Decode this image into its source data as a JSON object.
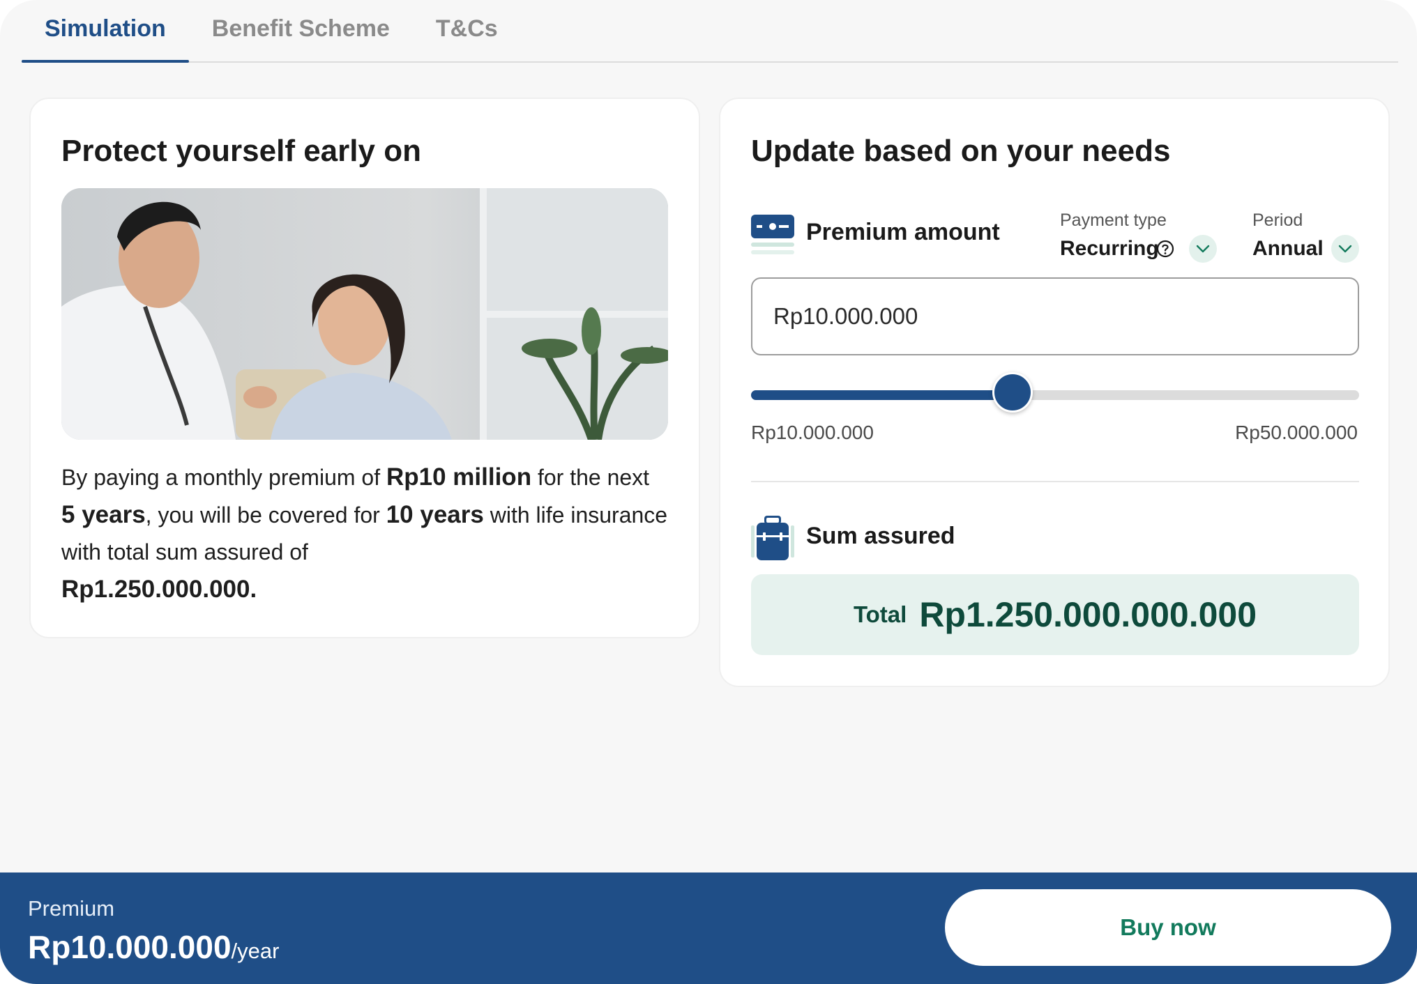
{
  "tabs": [
    {
      "label": "Simulation",
      "active": true
    },
    {
      "label": "Benefit Scheme",
      "active": false
    },
    {
      "label": "T&Cs",
      "active": false
    }
  ],
  "left_card": {
    "title": "Protect yourself early on",
    "image_alt_icon": "doctor-patient-photo",
    "description": {
      "p1": "By paying a monthly premium of ",
      "b1": "Rp10 million",
      "p2": " for the next ",
      "b2": "5 years",
      "p3": ", you will be covered for ",
      "b3": "10 years",
      "p4": " with life insurance with total sum assured of ",
      "b4": "Rp1.250.000.000."
    }
  },
  "right_card": {
    "title": "Update based on your needs",
    "premium": {
      "label": "Premium amount",
      "icon": "money-card-icon",
      "payment_type_label": "Payment type",
      "payment_type_value": "Recurring",
      "period_label": "Period",
      "period_value": "Annual",
      "input_value": "Rp10.000.000",
      "slider_min_label": "Rp10.000.000",
      "slider_max_label": "Rp50.000.000",
      "slider_level": 0.43
    },
    "sum_assured": {
      "label": "Sum assured",
      "icon": "briefcase-icon",
      "total_label": "Total",
      "total_value": "Rp1.250.000.000.000"
    }
  },
  "footer": {
    "label": "Premium",
    "amount": "Rp10.000.000",
    "per": "/year",
    "buy_label": "Buy now"
  },
  "colors": {
    "primary": "#1f4e87",
    "accent_green": "#127a5c",
    "total_bg": "#e6f2ee"
  }
}
